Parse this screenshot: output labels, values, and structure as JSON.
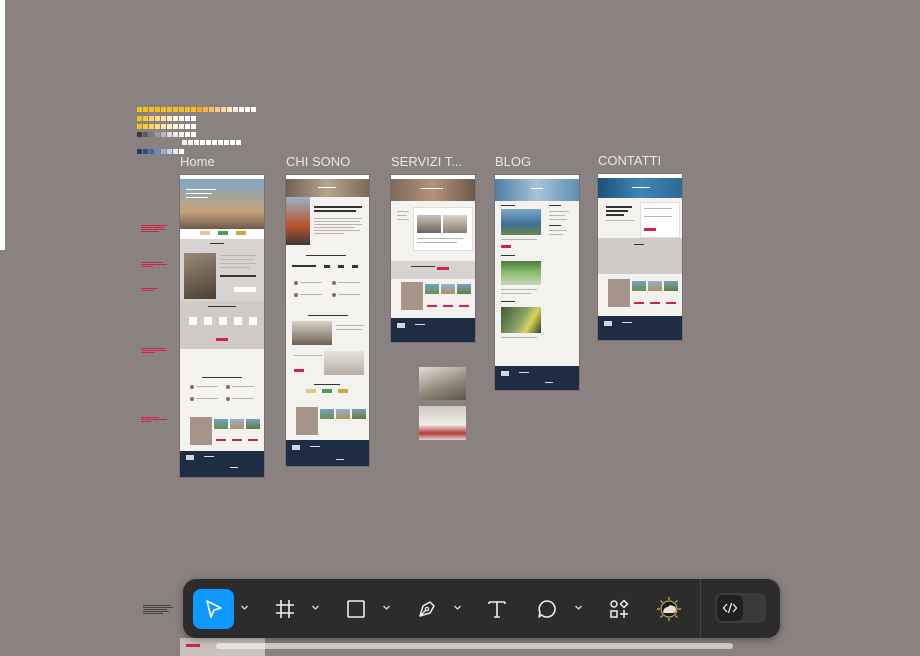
{
  "canvas": {
    "background": "#8a8280",
    "frames": [
      {
        "id": "home",
        "label": "Home"
      },
      {
        "id": "chi-sono",
        "label": "CHI SONO"
      },
      {
        "id": "servizi",
        "label": "SERVIZI T..."
      },
      {
        "id": "blog",
        "label": "BLOG"
      },
      {
        "id": "contatti",
        "label": "CONTATTI"
      }
    ],
    "palette_colors": [
      "#f2c21b",
      "#f5a623",
      "#d9d9d9",
      "#5a5a5a",
      "#1e3a6e"
    ]
  },
  "toolbar": {
    "tools": [
      {
        "name": "move-tool",
        "icon": "cursor-arrow-icon",
        "active": true,
        "has_menu": true
      },
      {
        "name": "frame-tool",
        "icon": "frame-hash-icon",
        "active": false,
        "has_menu": true
      },
      {
        "name": "rectangle-tool",
        "icon": "square-icon",
        "active": false,
        "has_menu": true
      },
      {
        "name": "pen-tool",
        "icon": "pen-nib-icon",
        "active": false,
        "has_menu": true
      },
      {
        "name": "text-tool",
        "icon": "text-t-icon",
        "active": false,
        "has_menu": false
      },
      {
        "name": "comment-tool",
        "icon": "speech-bubble-icon",
        "active": false,
        "has_menu": true
      },
      {
        "name": "assets-tool",
        "icon": "components-icon",
        "active": false,
        "has_menu": false
      },
      {
        "name": "ai-tool",
        "icon": "sun-cloud-icon",
        "active": false,
        "has_menu": false
      }
    ],
    "dev_mode_toggle": {
      "icon": "code-brackets-icon",
      "on": false
    },
    "accent_color": "#0d99ff"
  }
}
